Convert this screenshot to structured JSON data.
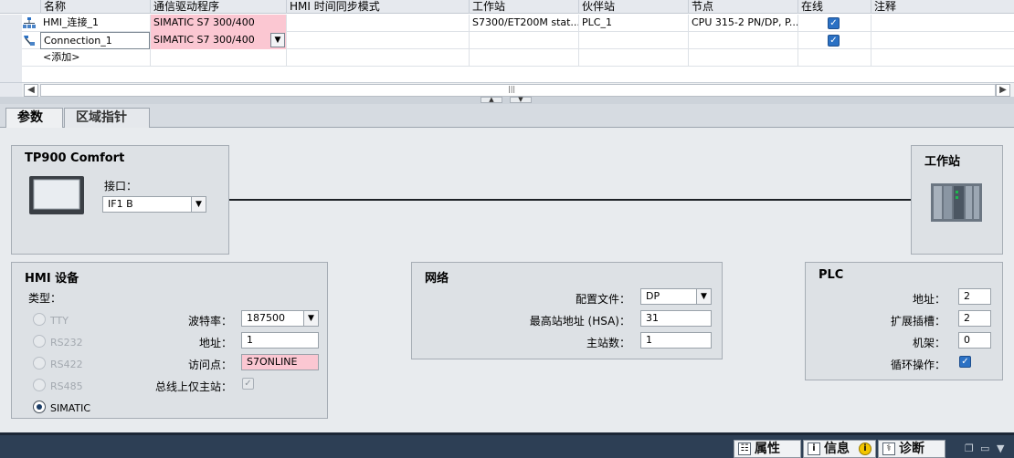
{
  "table": {
    "columns": [
      "名称",
      "通信驱动程序",
      "HMI 时间同步模式",
      "工作站",
      "伙伴站",
      "节点",
      "在线",
      "注释"
    ],
    "rows": [
      {
        "name": "HMI_连接_1",
        "driver": "SIMATIC S7 300/400",
        "time_sync": "",
        "station": "S7300/ET200M stat...",
        "partner": "PLC_1",
        "node": "CPU 315-2 PN/DP, P...",
        "online": true,
        "comment": ""
      },
      {
        "name": "Connection_1",
        "driver": "SIMATIC S7 300/400",
        "time_sync": "",
        "station": "",
        "partner": "",
        "node": "",
        "online": true,
        "comment": ""
      }
    ],
    "add_label": "<添加>"
  },
  "tabs": [
    {
      "label": "参数"
    },
    {
      "label": "区域指针"
    }
  ],
  "hmi_device_box": {
    "title": "TP900 Comfort",
    "interface_label": "接口：",
    "interface_value": "IF1 B"
  },
  "station_box": {
    "title": "工作站"
  },
  "hmi_settings": {
    "title": "HMI 设备",
    "type_label": "类型：",
    "types": [
      {
        "label": "TTY",
        "selected": false
      },
      {
        "label": "RS232",
        "selected": false
      },
      {
        "label": "RS422",
        "selected": false
      },
      {
        "label": "RS485",
        "selected": false
      },
      {
        "label": "SIMATIC",
        "selected": true
      }
    ],
    "baud_label": "波特率：",
    "baud_value": "187500",
    "address_label": "地址：",
    "address_value": "1",
    "access_label": "访问点：",
    "access_value": "S7ONLINE",
    "only_master_label": "总线上仅主站：",
    "only_master": true
  },
  "network": {
    "title": "网络",
    "profile_label": "配置文件：",
    "profile_value": "DP",
    "hsa_label": "最高站地址 (HSA)：",
    "hsa_value": "31",
    "masters_label": "主站数：",
    "masters_value": "1"
  },
  "plc": {
    "title": "PLC",
    "address_label": "地址：",
    "address_value": "2",
    "slot_label": "扩展插槽：",
    "slot_value": "2",
    "rack_label": "机架：",
    "rack_value": "0",
    "cyclic_label": "循环操作：",
    "cyclic": true
  },
  "statusbar": {
    "properties": "属性",
    "info": "信息",
    "diagnostics": "诊断"
  },
  "colors": {
    "accent": "#2b71c4",
    "error_fill": "#fbc7d2",
    "status_bar": "#2d3f55"
  }
}
